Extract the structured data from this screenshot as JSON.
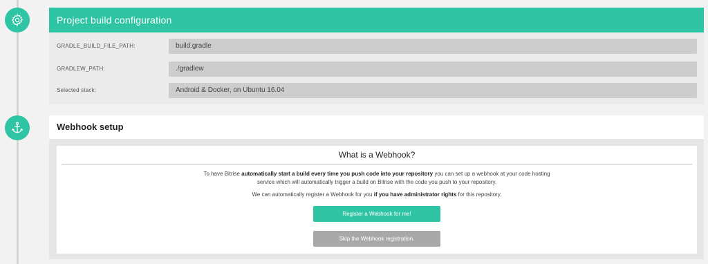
{
  "config": {
    "title": "Project build configuration",
    "rows": [
      {
        "label": "GRADLE_BUILD_FILE_PATH:",
        "value": "build.gradle"
      },
      {
        "label": "GRADLEW_PATH:",
        "value": "./gradlew"
      },
      {
        "label": "Selected stack:",
        "value": "Android & Docker, on Ubuntu 16.04"
      }
    ]
  },
  "webhook": {
    "title": "Webhook setup",
    "box_title": "What is a Webhook?",
    "desc_1": "To have Bitrise ",
    "desc_bold": "automatically start a build every time you push code into your repository",
    "desc_2": " you can set up a webhook at your code hosting service which will automatically trigger a build on Bitrise with the code you push to your repository.",
    "note_1": "We can automatically register a Webhook for you ",
    "note_bold": "if you have administrator rights",
    "note_2": " for this repository.",
    "register_label": "Register a Webhook for me!",
    "skip_label": "Skip the Webhook registration."
  },
  "icons": {
    "step_1": "gear-icon",
    "step_2": "anchor-icon"
  },
  "colors": {
    "accent": "#2fc4a3",
    "skip_button": "#a8a8a8"
  }
}
